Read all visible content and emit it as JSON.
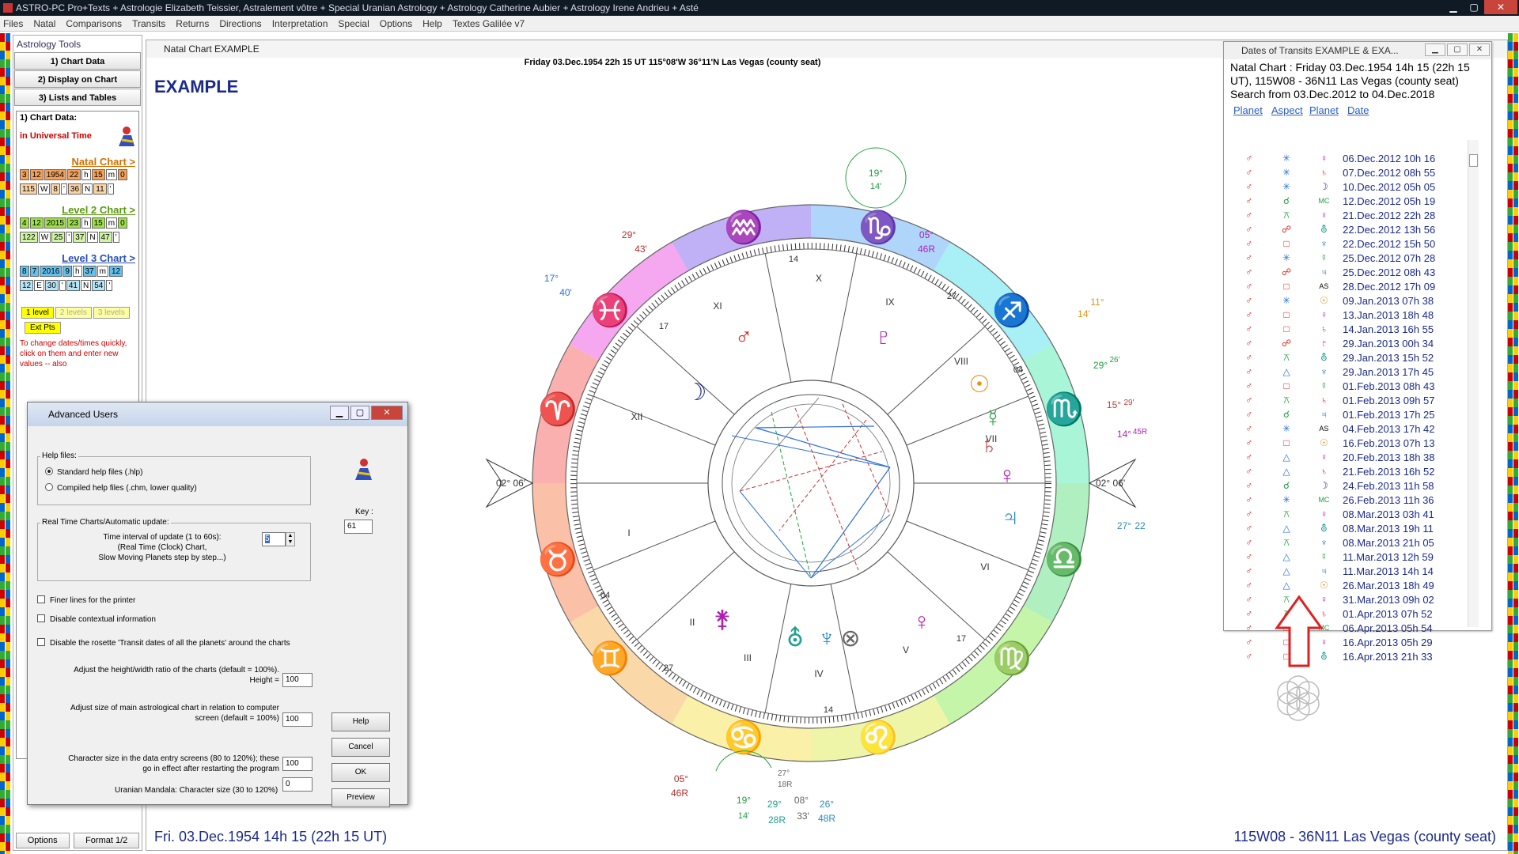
{
  "window": {
    "title": "ASTRO-PC Pro+Texts + Astrologie Elizabeth Teissier, Astralement vôtre + Special Uranian Astrology + Astrology Catherine Aubier + Astrology Irene Andrieu + Asté"
  },
  "menu": [
    "Files",
    "Natal",
    "Comparisons",
    "Transits",
    "Returns",
    "Directions",
    "Interpretation",
    "Special",
    "Options",
    "Help",
    "Textes Galilée v7"
  ],
  "tools": {
    "header": "Astrology Tools",
    "buttons": [
      "1) Chart Data",
      "2) Display on Chart",
      "3) Lists and Tables"
    ],
    "section_title": "1) Chart Data:",
    "ut_label": "in Universal Time",
    "natal_link": "Natal Chart >",
    "level2_link": "Level 2 Chart >",
    "level3_link": "Level 3 Chart >",
    "natal_date": [
      "3",
      "12",
      "1954",
      "22",
      "h",
      "15",
      "m",
      "0"
    ],
    "natal_loc": [
      "115",
      "W",
      "8",
      "'",
      "36",
      "N",
      "11",
      "'"
    ],
    "l2_date": [
      "4",
      "12",
      "2015",
      "23",
      "h",
      "15",
      "m",
      "0"
    ],
    "l2_loc": [
      "122",
      "W",
      "25",
      "'",
      "37",
      "N",
      "47",
      "'"
    ],
    "l3_date": [
      "8",
      "7",
      "2016",
      "9",
      "h",
      "37",
      "m",
      "12"
    ],
    "l3_loc": [
      "12",
      "E",
      "30",
      "'",
      "41",
      "N",
      "54",
      "'"
    ],
    "levels": [
      "1 level",
      "2 levels",
      "3 levels"
    ],
    "ext_pts": "Ext Pts",
    "note": "To change dates/times quickly, click on them and enter new values -- also",
    "bottom_buttons": [
      "Options",
      "Format 1/2"
    ]
  },
  "chart_window": {
    "title": "Natal Chart  EXAMPLE",
    "subheader": "Friday 03.Dec.1954 22h 15 UT 115°08'W 36°11'N  Las Vegas (county seat)",
    "big_title": "EXAMPLE",
    "bottom_left": "Fri. 03.Dec.1954 14h 15 (22h 15 UT)",
    "bottom_right": "115W08 - 36N11  Las Vegas (county seat)",
    "houses": [
      "I",
      "II",
      "III",
      "IV",
      "V",
      "VI",
      "VII",
      "VIII",
      "IX",
      "X",
      "XI",
      "XII"
    ],
    "asc_label": "02° 06'",
    "desc_label": "02° 06'",
    "degree_labels": [
      "29°",
      "43'",
      "05°",
      "46R",
      "17°",
      "40'",
      "11°",
      "14'",
      "19°",
      "14'",
      "29°",
      "26'",
      "15°",
      "29'",
      "14°",
      "45R",
      "27°",
      "22",
      "05°",
      "46R",
      "19°",
      "14'",
      "27°",
      "18R",
      "29°",
      "28R",
      "08°",
      "33'",
      "26°",
      "48R"
    ],
    "cusp_degrees": [
      "14",
      "17",
      "27",
      "04",
      "04",
      "27",
      "14",
      "17"
    ],
    "colors": {
      "title": "#1a2a8a",
      "mars": "#e02020",
      "venus": "#b020b0",
      "jupiter": "#1a8ac0"
    }
  },
  "transits": {
    "title": "Dates of Transits  EXAMPLE & EXA...",
    "info_lines": [
      "Natal Chart : Friday 03.Dec.1954 14h 15 (22h 15",
      "UT), 115W08 - 36N11  Las Vegas (county seat)",
      "Search from 03.Dec.2012 to 04.Dec.2018"
    ],
    "columns": [
      "Planet",
      "Aspect",
      "Planet",
      "Date"
    ],
    "rows": [
      {
        "p1": "♂",
        "asp": "✳",
        "asp_c": "#2a6fd8",
        "p2": "♀",
        "p2_c": "#b020b0",
        "date": "06.Dec.2012 10h 16"
      },
      {
        "p1": "♂",
        "asp": "✳",
        "asp_c": "#2a6fd8",
        "p2": "♄",
        "p2_c": "#c04040",
        "date": "07.Dec.2012 08h 55"
      },
      {
        "p1": "♂",
        "asp": "✳",
        "asp_c": "#2a6fd8",
        "p2": "☽",
        "p2_c": "#1a2a8a",
        "date": "10.Dec.2012 05h 05"
      },
      {
        "p1": "♂",
        "asp": "☌",
        "asp_c": "#20a040",
        "p2": "MC",
        "p2_c": "#20a040",
        "date": "12.Dec.2012 05h 19"
      },
      {
        "p1": "♂",
        "asp": "⚻",
        "asp_c": "#20a040",
        "p2": "♀",
        "p2_c": "#b020b0",
        "date": "21.Dec.2012 22h 28"
      },
      {
        "p1": "♂",
        "asp": "☍",
        "asp_c": "#e02020",
        "p2": "⛢",
        "p2_c": "#20a090",
        "date": "22.Dec.2012 13h 56"
      },
      {
        "p1": "♂",
        "asp": "□",
        "asp_c": "#e02020",
        "p2": "♆",
        "p2_c": "#2a6fd8",
        "date": "22.Dec.2012 15h 50"
      },
      {
        "p1": "♂",
        "asp": "✳",
        "asp_c": "#2a6fd8",
        "p2": "☿",
        "p2_c": "#20a040",
        "date": "25.Dec.2012 07h 28"
      },
      {
        "p1": "♂",
        "asp": "☍",
        "asp_c": "#e02020",
        "p2": "♃",
        "p2_c": "#2a6fd8",
        "date": "25.Dec.2012 08h 43"
      },
      {
        "p1": "♂",
        "asp": "□",
        "asp_c": "#e02020",
        "p2": "AS",
        "p2_c": "#000",
        "date": "28.Dec.2012 17h 09"
      },
      {
        "p1": "♂",
        "asp": "✳",
        "asp_c": "#2a6fd8",
        "p2": "☉",
        "p2_c": "#e89010",
        "date": "09.Jan.2013 07h 38"
      },
      {
        "p1": "♂",
        "asp": "□",
        "asp_c": "#e02020",
        "p2": "♀",
        "p2_c": "#b020b0",
        "date": "13.Jan.2013 18h 48"
      },
      {
        "p1": "♂",
        "asp": "□",
        "asp_c": "#e02020",
        "p2": "♄",
        "p2_c": "#c04040",
        "date": "14.Jan.2013 16h 55"
      },
      {
        "p1": "♂",
        "asp": "☍",
        "asp_c": "#e02020",
        "p2": "♇",
        "p2_c": "#b020b0",
        "date": "29.Jan.2013 00h 34"
      },
      {
        "p1": "♂",
        "asp": "⚻",
        "asp_c": "#20a040",
        "p2": "⛢",
        "p2_c": "#20a090",
        "date": "29.Jan.2013 15h 52"
      },
      {
        "p1": "♂",
        "asp": "△",
        "asp_c": "#2a6fd8",
        "p2": "♆",
        "p2_c": "#2a6fd8",
        "date": "29.Jan.2013 17h 45"
      },
      {
        "p1": "♂",
        "asp": "□",
        "asp_c": "#e02020",
        "p2": "☿",
        "p2_c": "#20a040",
        "date": "01.Feb.2013 08h 43"
      },
      {
        "p1": "♂",
        "asp": "⚻",
        "asp_c": "#20a040",
        "p2": "♄",
        "p2_c": "#c04040",
        "date": "01.Feb.2013 09h 57"
      },
      {
        "p1": "♂",
        "asp": "☌",
        "asp_c": "#20a040",
        "p2": "♃",
        "p2_c": "#2a6fd8",
        "date": "01.Feb.2013 17h 25"
      },
      {
        "p1": "♂",
        "asp": "✳",
        "asp_c": "#2a6fd8",
        "p2": "AS",
        "p2_c": "#000",
        "date": "04.Feb.2013 17h 42"
      },
      {
        "p1": "♂",
        "asp": "□",
        "asp_c": "#e02020",
        "p2": "☉",
        "p2_c": "#e89010",
        "date": "16.Feb.2013 07h 13"
      },
      {
        "p1": "♂",
        "asp": "△",
        "asp_c": "#2a6fd8",
        "p2": "♀",
        "p2_c": "#b020b0",
        "date": "20.Feb.2013 18h 38"
      },
      {
        "p1": "♂",
        "asp": "△",
        "asp_c": "#2a6fd8",
        "p2": "♄",
        "p2_c": "#c04040",
        "date": "21.Feb.2013 16h 52"
      },
      {
        "p1": "♂",
        "asp": "☌",
        "asp_c": "#20a040",
        "p2": "☽",
        "p2_c": "#1a2a8a",
        "date": "24.Feb.2013 11h 58"
      },
      {
        "p1": "♂",
        "asp": "✳",
        "asp_c": "#2a6fd8",
        "p2": "MC",
        "p2_c": "#20a040",
        "date": "26.Feb.2013 11h 36"
      },
      {
        "p1": "♂",
        "asp": "⚻",
        "asp_c": "#20a040",
        "p2": "♀",
        "p2_c": "#b020b0",
        "date": "08.Mar.2013 03h 41"
      },
      {
        "p1": "♂",
        "asp": "△",
        "asp_c": "#2a6fd8",
        "p2": "⛢",
        "p2_c": "#20a090",
        "date": "08.Mar.2013 19h 11"
      },
      {
        "p1": "♂",
        "asp": "⚻",
        "asp_c": "#20a040",
        "p2": "♆",
        "p2_c": "#2a6fd8",
        "date": "08.Mar.2013 21h 05"
      },
      {
        "p1": "♂",
        "asp": "△",
        "asp_c": "#2a6fd8",
        "p2": "☿",
        "p2_c": "#20a040",
        "date": "11.Mar.2013 12h 59"
      },
      {
        "p1": "♂",
        "asp": "△",
        "asp_c": "#2a6fd8",
        "p2": "♃",
        "p2_c": "#2a6fd8",
        "date": "11.Mar.2013 14h 14"
      },
      {
        "p1": "♂",
        "asp": "△",
        "asp_c": "#2a6fd8",
        "p2": "☉",
        "p2_c": "#e89010",
        "date": "26.Mar.2013 18h 49"
      },
      {
        "p1": "♂",
        "asp": "⚻",
        "asp_c": "#20a040",
        "p2": "♀",
        "p2_c": "#b020b0",
        "date": "31.Mar.2013 09h 02"
      },
      {
        "p1": "♂",
        "asp": "⚻",
        "asp_c": "#20a040",
        "p2": "♄",
        "p2_c": "#c04040",
        "date": "01.Apr.2013 07h 52"
      },
      {
        "p1": "♂",
        "asp": "□",
        "asp_c": "#e02020",
        "p2": "MC",
        "p2_c": "#20a040",
        "date": "06.Apr.2013 05h 54"
      },
      {
        "p1": "♂",
        "asp": "□",
        "asp_c": "#e02020",
        "p2": "♀",
        "p2_c": "#b020b0",
        "date": "16.Apr.2013 05h 29"
      },
      {
        "p1": "♂",
        "asp": "□",
        "asp_c": "#e02020",
        "p2": "⛢",
        "p2_c": "#20a090",
        "date": "16.Apr.2013 21h 33"
      }
    ]
  },
  "dialog": {
    "title": "Advanced Users",
    "help_files_label": "Help files:",
    "radio1": "Standard help files (.hlp)",
    "radio2": "Compiled help files (.chm, lower quality)",
    "realtime_label": "Real Time Charts/Automatic update:",
    "interval_text": "Time interval of update (1 to 60s):",
    "interval_text2": "(Real Time (Clock) Chart,",
    "interval_text3": "Slow Moving Planets step by step...)",
    "interval_value": "5",
    "key_label": "Key :",
    "key_value": "61",
    "check1": "Finer lines for the printer",
    "check2": "Disable contextual information",
    "check3": "Disable the rosette 'Transit dates of all the planets' around the charts",
    "ratio_text": "Adjust the height/width ratio of the charts (default = 100%).",
    "ratio_text2": "Height =",
    "ratio_value": "100",
    "size_text": "Adjust size of main astrological chart in relation to computer",
    "size_text2": "screen (default = 100%)",
    "size_value": "100",
    "char_text": "Character size in the data entry screens (80 to 120%); these",
    "char_text2": "go in effect after restarting the program",
    "char_value": "100",
    "mandala_text": "Uranian Mandala: Character size (30 to 120%)",
    "mandala_value": "0",
    "buttons": [
      "Help",
      "Cancel",
      "OK",
      "Preview"
    ]
  }
}
